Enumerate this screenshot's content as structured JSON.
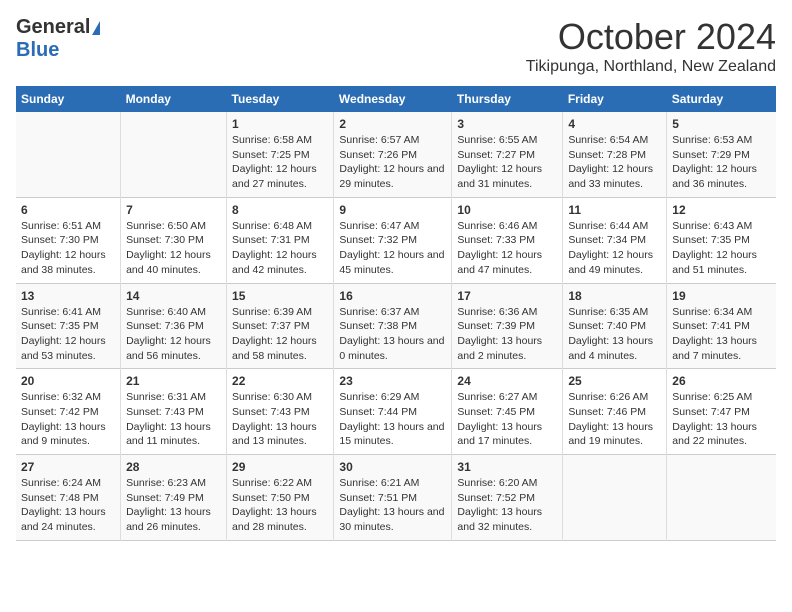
{
  "header": {
    "logo_general": "General",
    "logo_blue": "Blue",
    "month": "October 2024",
    "location": "Tikipunga, Northland, New Zealand"
  },
  "weekdays": [
    "Sunday",
    "Monday",
    "Tuesday",
    "Wednesday",
    "Thursday",
    "Friday",
    "Saturday"
  ],
  "weeks": [
    [
      {
        "day": "",
        "info": ""
      },
      {
        "day": "",
        "info": ""
      },
      {
        "day": "1",
        "info": "Sunrise: 6:58 AM\nSunset: 7:25 PM\nDaylight: 12 hours and 27 minutes."
      },
      {
        "day": "2",
        "info": "Sunrise: 6:57 AM\nSunset: 7:26 PM\nDaylight: 12 hours and 29 minutes."
      },
      {
        "day": "3",
        "info": "Sunrise: 6:55 AM\nSunset: 7:27 PM\nDaylight: 12 hours and 31 minutes."
      },
      {
        "day": "4",
        "info": "Sunrise: 6:54 AM\nSunset: 7:28 PM\nDaylight: 12 hours and 33 minutes."
      },
      {
        "day": "5",
        "info": "Sunrise: 6:53 AM\nSunset: 7:29 PM\nDaylight: 12 hours and 36 minutes."
      }
    ],
    [
      {
        "day": "6",
        "info": "Sunrise: 6:51 AM\nSunset: 7:30 PM\nDaylight: 12 hours and 38 minutes."
      },
      {
        "day": "7",
        "info": "Sunrise: 6:50 AM\nSunset: 7:30 PM\nDaylight: 12 hours and 40 minutes."
      },
      {
        "day": "8",
        "info": "Sunrise: 6:48 AM\nSunset: 7:31 PM\nDaylight: 12 hours and 42 minutes."
      },
      {
        "day": "9",
        "info": "Sunrise: 6:47 AM\nSunset: 7:32 PM\nDaylight: 12 hours and 45 minutes."
      },
      {
        "day": "10",
        "info": "Sunrise: 6:46 AM\nSunset: 7:33 PM\nDaylight: 12 hours and 47 minutes."
      },
      {
        "day": "11",
        "info": "Sunrise: 6:44 AM\nSunset: 7:34 PM\nDaylight: 12 hours and 49 minutes."
      },
      {
        "day": "12",
        "info": "Sunrise: 6:43 AM\nSunset: 7:35 PM\nDaylight: 12 hours and 51 minutes."
      }
    ],
    [
      {
        "day": "13",
        "info": "Sunrise: 6:41 AM\nSunset: 7:35 PM\nDaylight: 12 hours and 53 minutes."
      },
      {
        "day": "14",
        "info": "Sunrise: 6:40 AM\nSunset: 7:36 PM\nDaylight: 12 hours and 56 minutes."
      },
      {
        "day": "15",
        "info": "Sunrise: 6:39 AM\nSunset: 7:37 PM\nDaylight: 12 hours and 58 minutes."
      },
      {
        "day": "16",
        "info": "Sunrise: 6:37 AM\nSunset: 7:38 PM\nDaylight: 13 hours and 0 minutes."
      },
      {
        "day": "17",
        "info": "Sunrise: 6:36 AM\nSunset: 7:39 PM\nDaylight: 13 hours and 2 minutes."
      },
      {
        "day": "18",
        "info": "Sunrise: 6:35 AM\nSunset: 7:40 PM\nDaylight: 13 hours and 4 minutes."
      },
      {
        "day": "19",
        "info": "Sunrise: 6:34 AM\nSunset: 7:41 PM\nDaylight: 13 hours and 7 minutes."
      }
    ],
    [
      {
        "day": "20",
        "info": "Sunrise: 6:32 AM\nSunset: 7:42 PM\nDaylight: 13 hours and 9 minutes."
      },
      {
        "day": "21",
        "info": "Sunrise: 6:31 AM\nSunset: 7:43 PM\nDaylight: 13 hours and 11 minutes."
      },
      {
        "day": "22",
        "info": "Sunrise: 6:30 AM\nSunset: 7:43 PM\nDaylight: 13 hours and 13 minutes."
      },
      {
        "day": "23",
        "info": "Sunrise: 6:29 AM\nSunset: 7:44 PM\nDaylight: 13 hours and 15 minutes."
      },
      {
        "day": "24",
        "info": "Sunrise: 6:27 AM\nSunset: 7:45 PM\nDaylight: 13 hours and 17 minutes."
      },
      {
        "day": "25",
        "info": "Sunrise: 6:26 AM\nSunset: 7:46 PM\nDaylight: 13 hours and 19 minutes."
      },
      {
        "day": "26",
        "info": "Sunrise: 6:25 AM\nSunset: 7:47 PM\nDaylight: 13 hours and 22 minutes."
      }
    ],
    [
      {
        "day": "27",
        "info": "Sunrise: 6:24 AM\nSunset: 7:48 PM\nDaylight: 13 hours and 24 minutes."
      },
      {
        "day": "28",
        "info": "Sunrise: 6:23 AM\nSunset: 7:49 PM\nDaylight: 13 hours and 26 minutes."
      },
      {
        "day": "29",
        "info": "Sunrise: 6:22 AM\nSunset: 7:50 PM\nDaylight: 13 hours and 28 minutes."
      },
      {
        "day": "30",
        "info": "Sunrise: 6:21 AM\nSunset: 7:51 PM\nDaylight: 13 hours and 30 minutes."
      },
      {
        "day": "31",
        "info": "Sunrise: 6:20 AM\nSunset: 7:52 PM\nDaylight: 13 hours and 32 minutes."
      },
      {
        "day": "",
        "info": ""
      },
      {
        "day": "",
        "info": ""
      }
    ]
  ]
}
